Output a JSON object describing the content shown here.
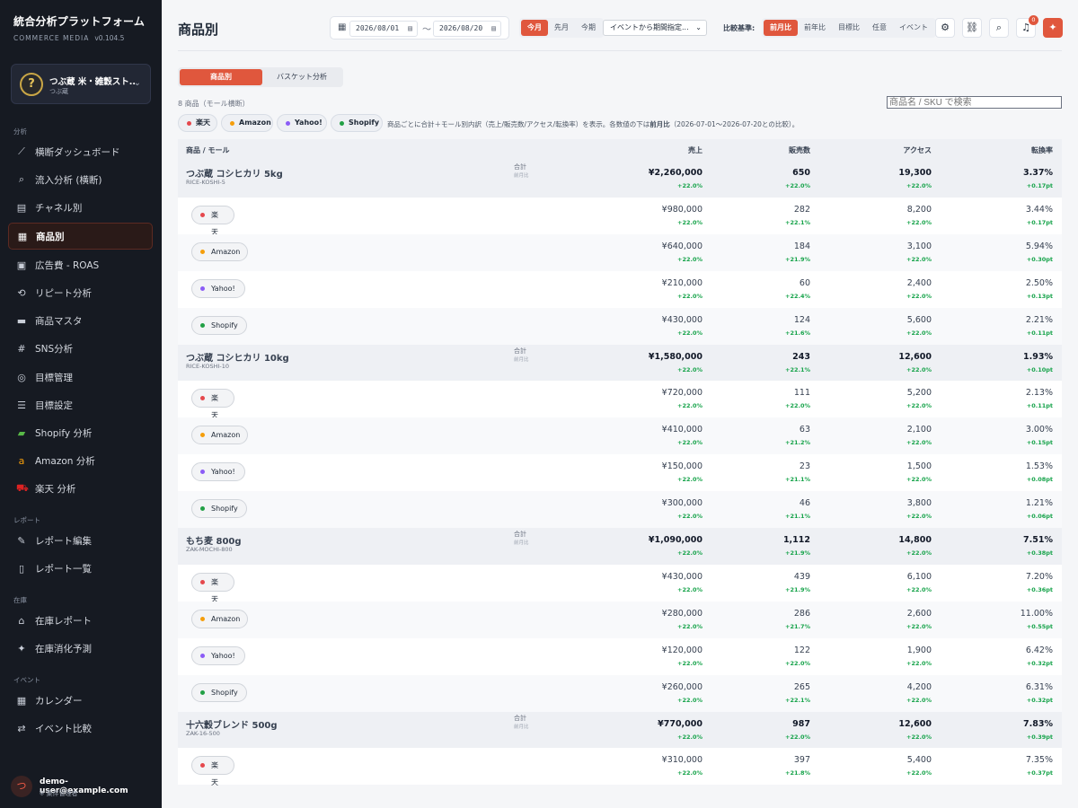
{
  "app": {
    "title": "統合分析プラットフォーム",
    "subtitle": "COMMERCE MEDIA",
    "version": "v0.104.5"
  },
  "store": {
    "name": "つぶ蔵 米・雑穀スト...",
    "sub": "つぶ蔵",
    "avatar": "?"
  },
  "sidebar": {
    "sections": {
      "analysis": "分析",
      "report": "レポート",
      "inventory": "在庫",
      "event": "イベント"
    },
    "items": [
      {
        "label": "横断ダッシュボード",
        "icon": "chart-line-icon",
        "glyph": "⟋"
      },
      {
        "label": "流入分析 (横断)",
        "icon": "search-icon",
        "glyph": "⌕"
      },
      {
        "label": "チャネル別",
        "icon": "store-icon",
        "glyph": "▤"
      },
      {
        "label": "商品別",
        "icon": "boxes-icon",
        "glyph": "▦"
      },
      {
        "label": "広告費 - ROAS",
        "icon": "ad-icon",
        "glyph": "▣"
      },
      {
        "label": "リピート分析",
        "icon": "repeat-icon",
        "glyph": "⟲"
      },
      {
        "label": "商品マスタ",
        "icon": "box-icon",
        "glyph": "▬"
      },
      {
        "label": "SNS分析",
        "icon": "hashtag-icon",
        "glyph": "#"
      },
      {
        "label": "目標管理",
        "icon": "target-icon",
        "glyph": "◎"
      },
      {
        "label": "目標設定",
        "icon": "sliders-icon",
        "glyph": "☰"
      },
      {
        "label": "Shopify 分析",
        "icon": "shopify-icon",
        "glyph": "▰"
      },
      {
        "label": "Amazon 分析",
        "icon": "amazon-icon",
        "glyph": "a"
      },
      {
        "label": "楽天 分析",
        "icon": "cart-icon",
        "glyph": "⛟"
      },
      {
        "label": "レポート編集",
        "icon": "edit-icon",
        "glyph": "✎"
      },
      {
        "label": "レポート一覧",
        "icon": "file-icon",
        "glyph": "▯"
      },
      {
        "label": "在庫レポート",
        "icon": "warehouse-icon",
        "glyph": "⌂"
      },
      {
        "label": "在庫消化予測",
        "icon": "wand-icon",
        "glyph": "✦"
      },
      {
        "label": "カレンダー",
        "icon": "calendar-icon",
        "glyph": "▦"
      },
      {
        "label": "イベント比較",
        "icon": "compare-icon",
        "glyph": "⇄"
      }
    ]
  },
  "user": {
    "email": "demo-user@example.com",
    "role": "案件管理者",
    "avatar": "つ"
  },
  "header": {
    "title": "商品別",
    "date_from": "2026/08/01",
    "date_to": "2026/08/20",
    "tilde": "〜",
    "period_buttons": [
      "今月",
      "先月",
      "今期"
    ],
    "event_select": "イベントから期間指定...",
    "compare_label": "比較基準:",
    "compare_buttons": [
      "前月比",
      "前年比",
      "目標比",
      "任意",
      "イベント"
    ],
    "notification_count": "0"
  },
  "tabs": [
    "商品別",
    "バスケット分析"
  ],
  "count_text": "8 商品（モール横断）",
  "search_placeholder": "商品名 / SKU で検索",
  "malls": [
    {
      "name": "楽天",
      "color": "#e5484d"
    },
    {
      "name": "Amazon",
      "color": "#f59e0b"
    },
    {
      "name": "Yahoo!",
      "color": "#8b5cf6"
    },
    {
      "name": "Shopify",
      "color": "#22a045"
    }
  ],
  "note_parts": {
    "pre": "商品ごとに合計＋モール別内訳（売上/販売数/アクセス/転換率）を表示。各数値の下は",
    "em": "前月比",
    "post": "（2026-07-01〜2026-07-20との比較）。"
  },
  "table": {
    "headers": [
      "商品 / モール",
      "売上",
      "販売数",
      "アクセス",
      "転換率"
    ],
    "total_label": "合計",
    "compare_sub": "前月比",
    "rows": [
      {
        "type": "product",
        "name": "つぶ蔵 コシヒカリ 5kg",
        "sku": "RICE-KOSHI-5",
        "sales": "¥2,260,000",
        "sales_d": "+22.0%",
        "units": "650",
        "units_d": "+22.0%",
        "access": "19,300",
        "access_d": "+22.0%",
        "cvr": "3.37%",
        "cvr_d": "+0.17pt"
      },
      {
        "type": "mall",
        "mall": "楽天",
        "color": "#e5484d",
        "sales": "¥980,000",
        "sales_d": "+22.0%",
        "units": "282",
        "units_d": "+22.1%",
        "access": "8,200",
        "access_d": "+22.0%",
        "cvr": "3.44%",
        "cvr_d": "+0.17pt"
      },
      {
        "type": "mall",
        "mall": "Amazon",
        "color": "#f59e0b",
        "sales": "¥640,000",
        "sales_d": "+22.0%",
        "units": "184",
        "units_d": "+21.9%",
        "access": "3,100",
        "access_d": "+22.0%",
        "cvr": "5.94%",
        "cvr_d": "+0.30pt"
      },
      {
        "type": "mall",
        "mall": "Yahoo!",
        "color": "#8b5cf6",
        "sales": "¥210,000",
        "sales_d": "+22.0%",
        "units": "60",
        "units_d": "+22.4%",
        "access": "2,400",
        "access_d": "+22.0%",
        "cvr": "2.50%",
        "cvr_d": "+0.13pt"
      },
      {
        "type": "mall",
        "mall": "Shopify",
        "color": "#22a045",
        "sales": "¥430,000",
        "sales_d": "+22.0%",
        "units": "124",
        "units_d": "+21.6%",
        "access": "5,600",
        "access_d": "+22.0%",
        "cvr": "2.21%",
        "cvr_d": "+0.11pt"
      },
      {
        "type": "product",
        "name": "つぶ蔵 コシヒカリ 10kg",
        "sku": "RICE-KOSHI-10",
        "sales": "¥1,580,000",
        "sales_d": "+22.0%",
        "units": "243",
        "units_d": "+22.1%",
        "access": "12,600",
        "access_d": "+22.0%",
        "cvr": "1.93%",
        "cvr_d": "+0.10pt"
      },
      {
        "type": "mall",
        "mall": "楽天",
        "color": "#e5484d",
        "sales": "¥720,000",
        "sales_d": "+22.0%",
        "units": "111",
        "units_d": "+22.0%",
        "access": "5,200",
        "access_d": "+22.0%",
        "cvr": "2.13%",
        "cvr_d": "+0.11pt"
      },
      {
        "type": "mall",
        "mall": "Amazon",
        "color": "#f59e0b",
        "sales": "¥410,000",
        "sales_d": "+22.0%",
        "units": "63",
        "units_d": "+21.2%",
        "access": "2,100",
        "access_d": "+22.0%",
        "cvr": "3.00%",
        "cvr_d": "+0.15pt"
      },
      {
        "type": "mall",
        "mall": "Yahoo!",
        "color": "#8b5cf6",
        "sales": "¥150,000",
        "sales_d": "+22.0%",
        "units": "23",
        "units_d": "+21.1%",
        "access": "1,500",
        "access_d": "+22.0%",
        "cvr": "1.53%",
        "cvr_d": "+0.08pt"
      },
      {
        "type": "mall",
        "mall": "Shopify",
        "color": "#22a045",
        "sales": "¥300,000",
        "sales_d": "+22.0%",
        "units": "46",
        "units_d": "+21.1%",
        "access": "3,800",
        "access_d": "+22.0%",
        "cvr": "1.21%",
        "cvr_d": "+0.06pt"
      },
      {
        "type": "product",
        "name": "もち麦 800g",
        "sku": "ZAK-MOCHI-800",
        "sales": "¥1,090,000",
        "sales_d": "+22.0%",
        "units": "1,112",
        "units_d": "+21.9%",
        "access": "14,800",
        "access_d": "+22.0%",
        "cvr": "7.51%",
        "cvr_d": "+0.38pt"
      },
      {
        "type": "mall",
        "mall": "楽天",
        "color": "#e5484d",
        "sales": "¥430,000",
        "sales_d": "+22.0%",
        "units": "439",
        "units_d": "+21.9%",
        "access": "6,100",
        "access_d": "+22.0%",
        "cvr": "7.20%",
        "cvr_d": "+0.36pt"
      },
      {
        "type": "mall",
        "mall": "Amazon",
        "color": "#f59e0b",
        "sales": "¥280,000",
        "sales_d": "+22.0%",
        "units": "286",
        "units_d": "+21.7%",
        "access": "2,600",
        "access_d": "+22.0%",
        "cvr": "11.00%",
        "cvr_d": "+0.55pt"
      },
      {
        "type": "mall",
        "mall": "Yahoo!",
        "color": "#8b5cf6",
        "sales": "¥120,000",
        "sales_d": "+22.0%",
        "units": "122",
        "units_d": "+22.0%",
        "access": "1,900",
        "access_d": "+22.0%",
        "cvr": "6.42%",
        "cvr_d": "+0.32pt"
      },
      {
        "type": "mall",
        "mall": "Shopify",
        "color": "#22a045",
        "sales": "¥260,000",
        "sales_d": "+22.0%",
        "units": "265",
        "units_d": "+22.1%",
        "access": "4,200",
        "access_d": "+22.0%",
        "cvr": "6.31%",
        "cvr_d": "+0.32pt"
      },
      {
        "type": "product",
        "name": "十六穀ブレンド 500g",
        "sku": "ZAK-16-500",
        "sales": "¥770,000",
        "sales_d": "+22.0%",
        "units": "987",
        "units_d": "+22.0%",
        "access": "12,600",
        "access_d": "+22.0%",
        "cvr": "7.83%",
        "cvr_d": "+0.39pt"
      },
      {
        "type": "mall",
        "mall": "楽天",
        "color": "#e5484d",
        "sales": "¥310,000",
        "sales_d": "+22.0%",
        "units": "397",
        "units_d": "+21.8%",
        "access": "5,400",
        "access_d": "+22.0%",
        "cvr": "7.35%",
        "cvr_d": "+0.37pt"
      }
    ]
  }
}
